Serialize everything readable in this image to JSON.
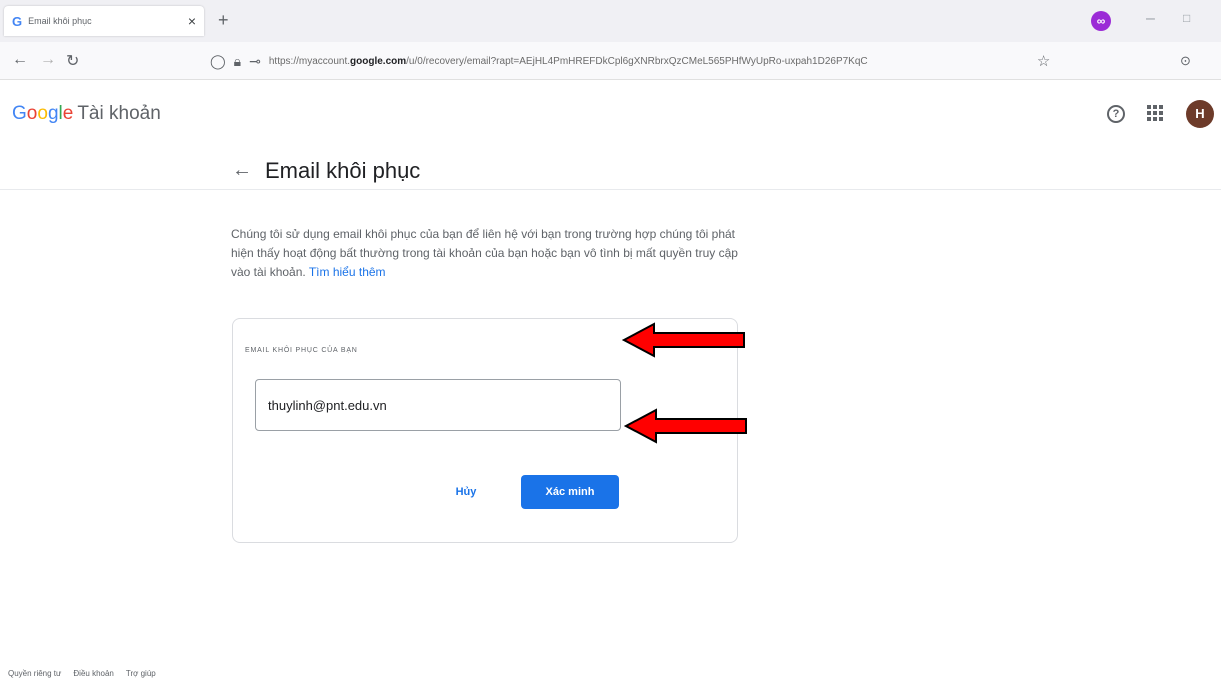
{
  "browser": {
    "tab_title": "Email khôi phục",
    "tab_close": "×",
    "new_tab": "+",
    "url_prefix": "https://myaccount.",
    "url_domain": "google.com",
    "url_rest": "/u/0/recovery/email?rapt=AEjHL4PmHREFDkCpl6gXNRbrxQzCMeL565PHfWyUpRo-uxpah1D26P7KqC"
  },
  "header": {
    "logo_letters": [
      "G",
      "o",
      "o",
      "g",
      "l",
      "e"
    ],
    "product_name": "Tài khoản",
    "avatar_initial": "H",
    "help_symbol": "?"
  },
  "page": {
    "back_symbol": "←",
    "title": "Email khôi phục",
    "description": "Chúng tôi sử dụng email khôi phục của bạn để liên hệ với bạn trong trường hợp chúng tôi phát hiện thấy hoạt động bất thường trong tài khoản của bạn hoặc bạn vô tình bị mất quyền truy cập vào tài khoản.",
    "learn_more": "Tìm hiểu thêm"
  },
  "card": {
    "label": "EMAIL KHÔI PHỤC CỦA BẠN",
    "email_value": "thuylinh@pnt.edu.vn",
    "cancel_label": "Hủy",
    "verify_label": "Xác minh"
  },
  "footer": {
    "links": [
      "Quyền riêng tư",
      "Điều khoản",
      "Trợ giúp"
    ]
  },
  "colors": {
    "accent": "#1a73e8",
    "annotation_arrow": "#ff0000"
  }
}
